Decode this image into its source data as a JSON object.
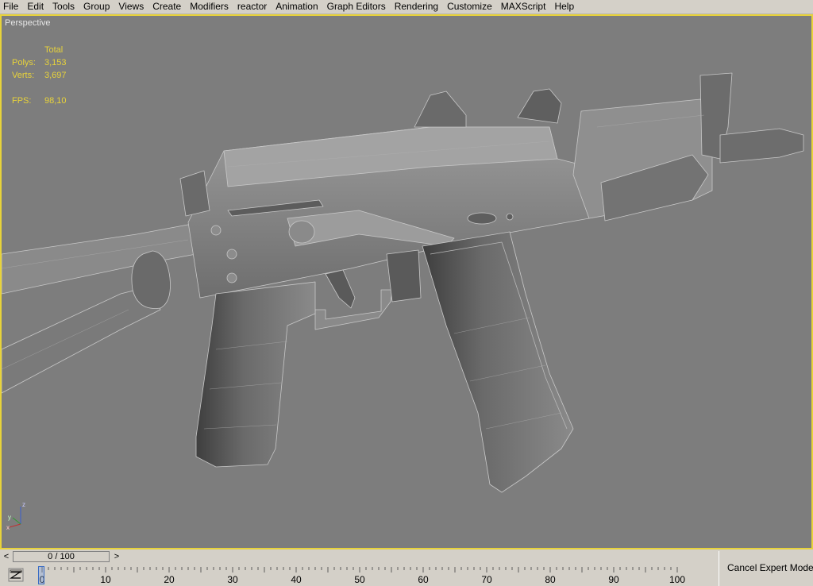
{
  "menu": [
    "File",
    "Edit",
    "Tools",
    "Group",
    "Views",
    "Create",
    "Modifiers",
    "reactor",
    "Animation",
    "Graph Editors",
    "Rendering",
    "Customize",
    "MAXScript",
    "Help"
  ],
  "viewport": {
    "label": "Perspective",
    "stats": {
      "header": "Total",
      "polys_label": "Polys:",
      "polys_value": "3,153",
      "verts_label": "Verts:",
      "verts_value": "3,697",
      "fps_label": "FPS:",
      "fps_value": "98,10"
    },
    "gizmo": {
      "z": "z",
      "x": "x",
      "y": "y"
    }
  },
  "timeslider": {
    "prev": "<",
    "next": ">",
    "position": "0 / 100"
  },
  "trackbar": {
    "ticks": [
      "0",
      "10",
      "20",
      "30",
      "40",
      "50",
      "60",
      "70",
      "80",
      "90",
      "100"
    ]
  },
  "right_panel": {
    "cancel_expert_mode": "Cancel Expert Mode"
  },
  "colors": {
    "viewport_bg": "#7d7d7d",
    "active_border": "#e8d33a",
    "stats_text": "#e8d33a",
    "ui_face": "#d4d0c8"
  }
}
